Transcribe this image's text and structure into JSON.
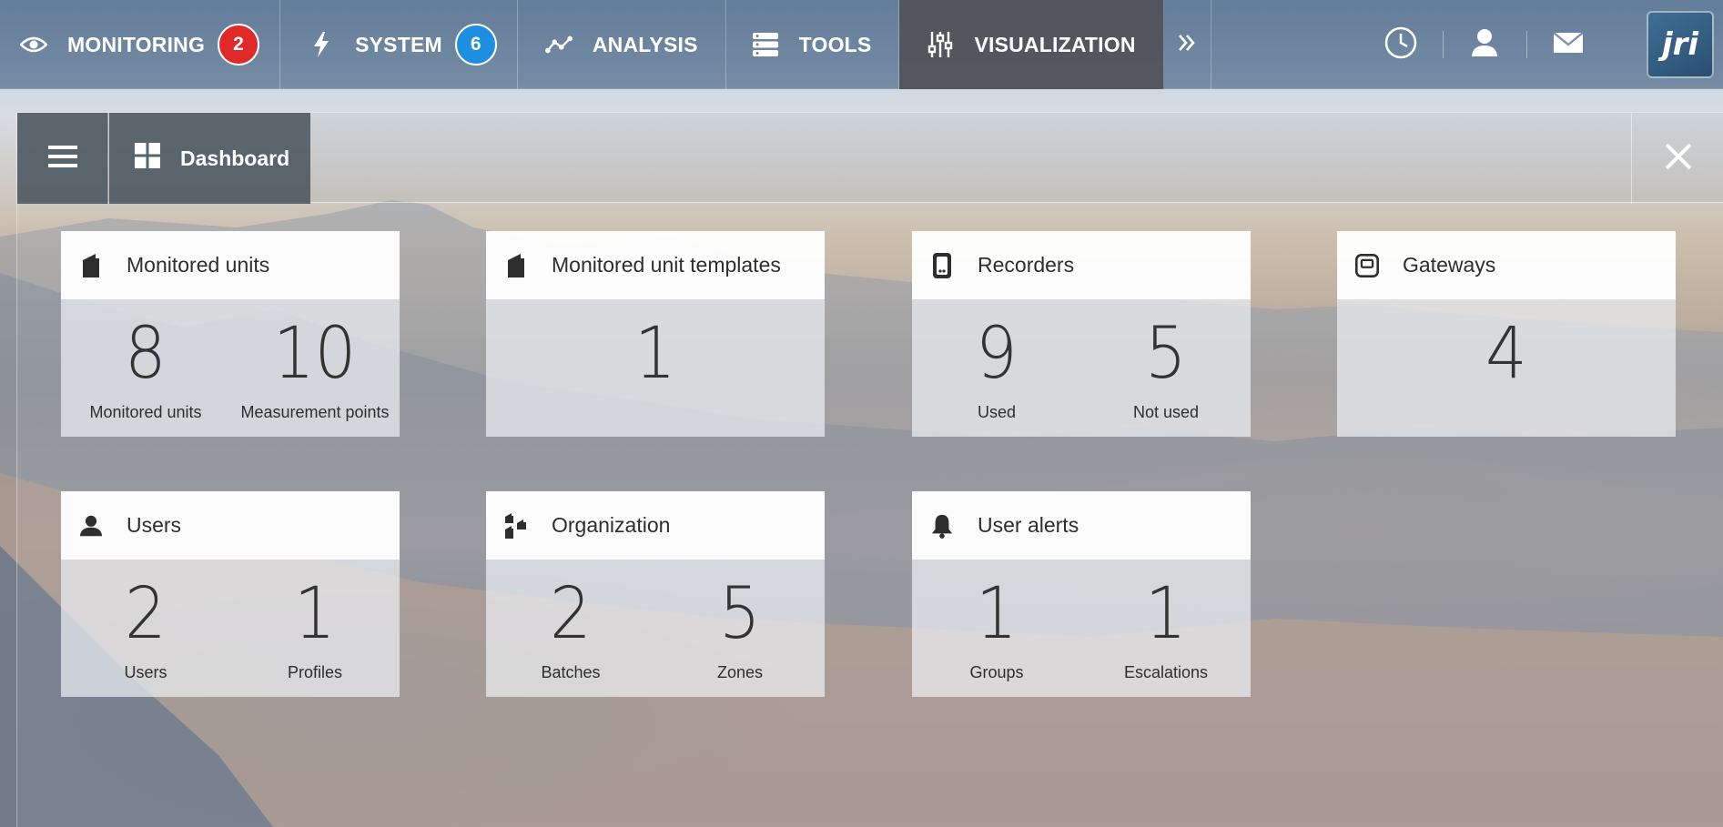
{
  "nav": {
    "items": [
      {
        "label": "MONITORING",
        "badge": "2",
        "badge_color": "#e02a2a",
        "icon": "eye-icon"
      },
      {
        "label": "SYSTEM",
        "badge": "6",
        "badge_color": "#1e8fe0",
        "icon": "bolt-icon"
      },
      {
        "label": "ANALYSIS",
        "icon": "line-graph-icon"
      },
      {
        "label": "TOOLS",
        "icon": "server-stack-icon"
      },
      {
        "label": "VISUALIZATION",
        "icon": "sliders-icon",
        "active": true
      }
    ],
    "more_icon": "double-chevron-right-icon",
    "right_icons": [
      "clock-icon",
      "user-icon",
      "mail-icon"
    ],
    "logo_text": "jri"
  },
  "dashboard": {
    "menu_icon": "hamburger-icon",
    "tab_label": "Dashboard",
    "tab_icon": "grid-icon",
    "close_icon": "close-icon"
  },
  "cards": [
    {
      "title": "Monitored units",
      "icon": "unit-icon",
      "stats": [
        {
          "value": "8",
          "label": "Monitored units"
        },
        {
          "value": "10",
          "label": "Measurement points"
        }
      ]
    },
    {
      "title": "Monitored unit templates",
      "icon": "unit-icon",
      "stats": [
        {
          "value": "1",
          "label": ""
        }
      ]
    },
    {
      "title": "Recorders",
      "icon": "recorder-icon",
      "stats": [
        {
          "value": "9",
          "label": "Used"
        },
        {
          "value": "5",
          "label": "Not used"
        }
      ]
    },
    {
      "title": "Gateways",
      "icon": "gateway-icon",
      "stats": [
        {
          "value": "4",
          "label": ""
        }
      ]
    },
    {
      "title": "Users",
      "icon": "user-icon",
      "stats": [
        {
          "value": "2",
          "label": "Users"
        },
        {
          "value": "1",
          "label": "Profiles"
        }
      ]
    },
    {
      "title": "Organization",
      "icon": "organization-icon",
      "stats": [
        {
          "value": "2",
          "label": "Batches"
        },
        {
          "value": "5",
          "label": "Zones"
        }
      ]
    },
    {
      "title": "User alerts",
      "icon": "bell-icon",
      "stats": [
        {
          "value": "1",
          "label": "Groups"
        },
        {
          "value": "1",
          "label": "Escalations"
        }
      ]
    }
  ]
}
